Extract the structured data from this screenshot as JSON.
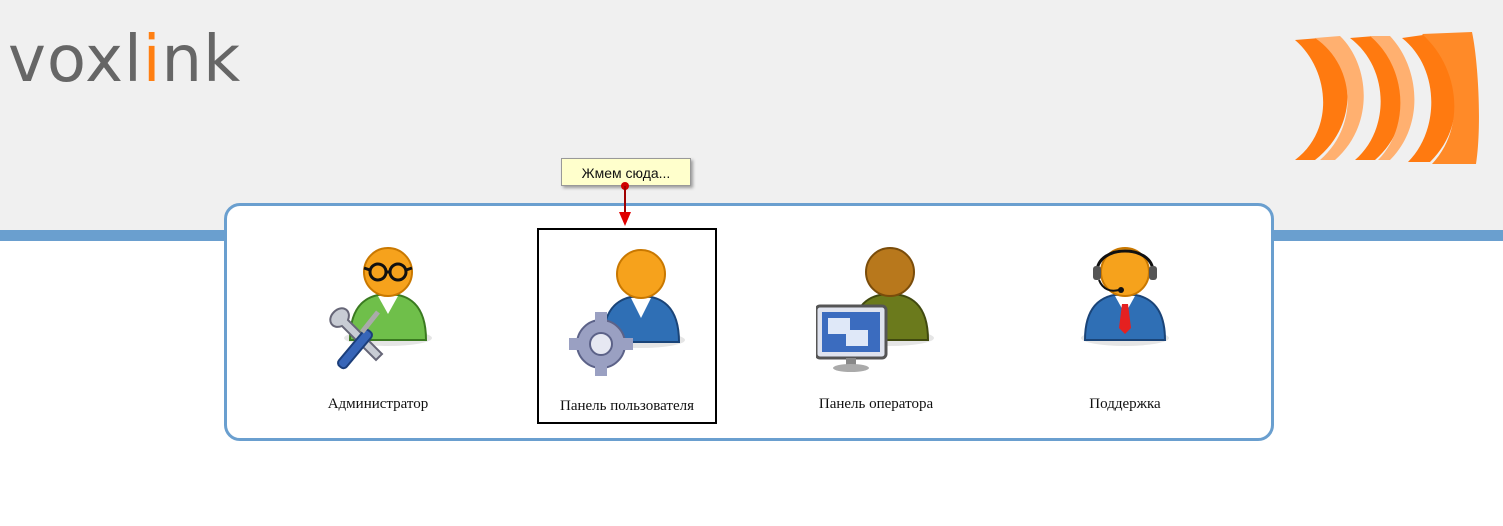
{
  "header": {
    "logo": {
      "text_start": "voxl",
      "text_accent": "i",
      "text_end": "nk",
      "accent_color": "#ff7f12"
    },
    "brand_mark_icon": "orange-wave-arcs-icon"
  },
  "tooltip": {
    "text": "Жмем сюда..."
  },
  "roles": [
    {
      "label": "Администратор",
      "icon": "admin-tools-person-icon"
    },
    {
      "label": "Панель пользователя",
      "icon": "user-gear-person-icon",
      "selected": true
    },
    {
      "label": "Панель оператора",
      "icon": "operator-monitor-person-icon"
    },
    {
      "label": "Поддержка",
      "icon": "support-headset-person-icon"
    }
  ],
  "colors": {
    "band": "#6a9fcf",
    "header_bg": "#f0f0f0"
  }
}
